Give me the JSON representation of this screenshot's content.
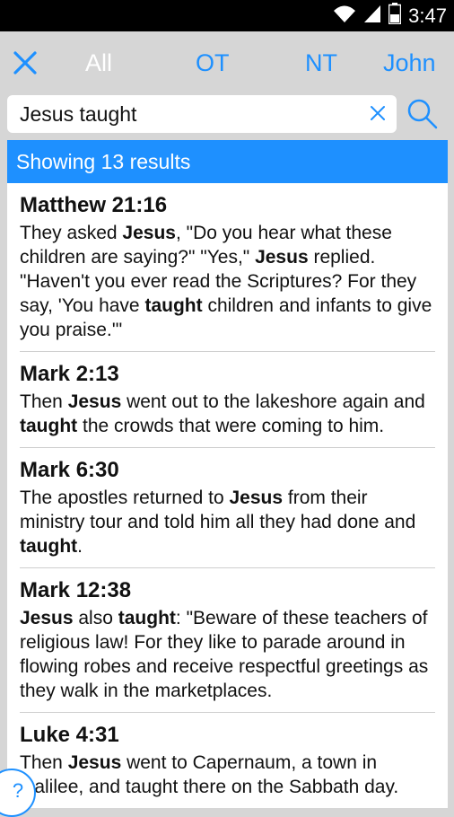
{
  "status": {
    "time": "3:47",
    "icons": [
      "wifi-icon",
      "signal-icon",
      "battery-icon"
    ]
  },
  "toolbar": {
    "close_icon": "close-icon",
    "tabs": [
      {
        "label": "All",
        "active": true
      },
      {
        "label": "OT",
        "active": false
      },
      {
        "label": "NT",
        "active": false
      },
      {
        "label": "John",
        "active": false
      }
    ]
  },
  "search": {
    "value": "Jesus taught",
    "clear_icon": "clear-icon",
    "search_icon": "search-icon"
  },
  "results": {
    "summary": "Showing 13 results",
    "items": [
      {
        "ref": "Matthew 21:16",
        "segments": [
          {
            "t": "They asked ",
            "b": false
          },
          {
            "t": "Jesus",
            "b": true
          },
          {
            "t": ", \"Do you hear what these children are saying?\" \"Yes,\" ",
            "b": false
          },
          {
            "t": "Jesus",
            "b": true
          },
          {
            "t": " replied. \"Haven't you ever read the Scriptures? For they say, 'You have ",
            "b": false
          },
          {
            "t": "taught",
            "b": true
          },
          {
            "t": " children and infants to give you praise.'\"",
            "b": false
          }
        ]
      },
      {
        "ref": "Mark 2:13",
        "segments": [
          {
            "t": "Then ",
            "b": false
          },
          {
            "t": "Jesus",
            "b": true
          },
          {
            "t": " went out to the lakeshore again and ",
            "b": false
          },
          {
            "t": "taught",
            "b": true
          },
          {
            "t": " the crowds that were coming to him.",
            "b": false
          }
        ]
      },
      {
        "ref": "Mark 6:30",
        "segments": [
          {
            "t": "The apostles returned to ",
            "b": false
          },
          {
            "t": "Jesus",
            "b": true
          },
          {
            "t": " from their ministry tour and told him all they had done and ",
            "b": false
          },
          {
            "t": "taught",
            "b": true
          },
          {
            "t": ".",
            "b": false
          }
        ]
      },
      {
        "ref": "Mark 12:38",
        "segments": [
          {
            "t": "Jesus",
            "b": true
          },
          {
            "t": " also ",
            "b": false
          },
          {
            "t": "taught",
            "b": true
          },
          {
            "t": ": \"Beware of these teachers of religious law! For they like to parade around in flowing robes and receive respectful greetings as they walk in the marketplaces.",
            "b": false
          }
        ]
      },
      {
        "ref": "Luke 4:31",
        "segments": [
          {
            "t": "Then ",
            "b": false
          },
          {
            "t": "Jesus",
            "b": true
          },
          {
            "t": " went to Capernaum, a town in Galilee, and taught there on the Sabbath day.",
            "b": false
          }
        ]
      }
    ]
  },
  "help": {
    "label": "?"
  },
  "colors": {
    "accent": "#1e90ff",
    "toolbar_bg": "#d6d6d6",
    "status_bg": "#000000"
  }
}
